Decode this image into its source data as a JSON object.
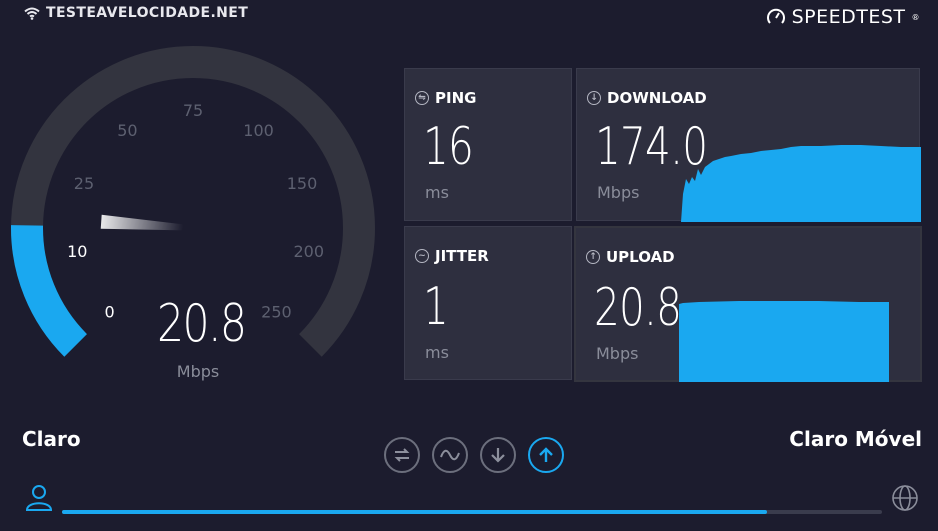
{
  "brand_left": {
    "text": "TESTEAVELOCIDADE.NET",
    "icon": "wifi-icon"
  },
  "brand_right": {
    "text": "SPEEDTEST",
    "trademark": "®",
    "icon": "speedometer-icon"
  },
  "gauge": {
    "value": "20.8",
    "unit": "Mbps",
    "ticks": [
      "0",
      "10",
      "25",
      "50",
      "75",
      "100",
      "150",
      "200",
      "250"
    ],
    "active_ticks": [
      "0",
      "10"
    ],
    "level_fraction": 0.17,
    "accent_color": "#1aa8f0"
  },
  "ping": {
    "label": "PING",
    "value": "16",
    "unit": "ms",
    "icon": "ping-icon"
  },
  "jitter": {
    "label": "JITTER",
    "value": "1",
    "unit": "ms",
    "icon": "jitter-icon"
  },
  "download": {
    "label": "DOWNLOAD",
    "value": "174.0",
    "unit": "Mbps",
    "icon": "download-icon"
  },
  "upload": {
    "label": "UPLOAD",
    "value": "20.8",
    "unit": "Mbps",
    "icon": "upload-icon"
  },
  "isp": {
    "left": "Claro",
    "right": "Claro Móvel"
  },
  "steps": [
    {
      "name": "ping-step",
      "icon": "ping-icon",
      "active": false
    },
    {
      "name": "jitter-step",
      "icon": "jitter-icon",
      "active": false
    },
    {
      "name": "download-step",
      "icon": "download-icon",
      "active": false
    },
    {
      "name": "upload-step",
      "icon": "upload-icon",
      "active": true
    }
  ],
  "progress_fraction": 0.86,
  "colors": {
    "background": "#1c1c2e",
    "panel": "#2e2f3f",
    "accent": "#1aa8f0"
  }
}
